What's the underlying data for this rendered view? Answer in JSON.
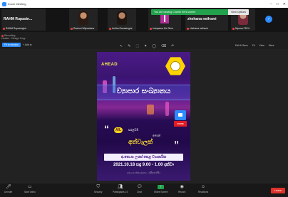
{
  "window": {
    "title": "Zoom Meeting"
  },
  "share_banner": {
    "message": "You are viewing Charith HX's screen",
    "options_label": "View Options"
  },
  "participants": [
    {
      "name": "RAHM Rupasin...",
      "label": "RAHM Rupasinghe",
      "type": "name-only"
    },
    {
      "name": "Rashmi Wijesekara",
      "type": "video"
    },
    {
      "name": "Anitha Ranasinghe",
      "type": "video"
    },
    {
      "name": "Indupama De Silva",
      "type": "avatar"
    },
    {
      "name": "zhehana nethsmi",
      "label": "zhehana nethsmi",
      "type": "name-only"
    },
    {
      "name": "Nipuna FDCL",
      "type": "video"
    }
  ],
  "share_toolbar": {
    "recording_label": "Recording",
    "speaker_label": "Header · Design Copy",
    "view_label": "Fit to window",
    "add_label": "Add to",
    "tools": [
      "↖",
      "✎",
      "⬚",
      "✦",
      "◯",
      "⌫",
      "↶"
    ],
    "right_tools": [
      "Edit & Save",
      "Fit",
      "View",
      "More"
    ]
  },
  "poster": {
    "logo_text": "AHEAD",
    "title": "ව්‍යාපාර සංඛ්‍යානය",
    "al_badge": "A/L",
    "sub1": "සරලවම",
    "sub2": "අපෙන්",
    "big_word": "අත්වැලක්",
    "zoom_label": "ZOOM",
    "host": "අ.පො.ස උසස් පෙළ ව්‍යාපාරික",
    "datetime": "2021.10.18 සඳු 9.00 - 1.00 දක්වා",
    "footer": "ගුරු මාර්ගෝපදේශනය · ඉදිරිපත් කිරීම"
  },
  "controls": [
    {
      "label": "Unmute",
      "icon": "mic-icon"
    },
    {
      "label": "Start Video",
      "icon": "video-icon"
    },
    {
      "label": "Security",
      "icon": "shield-icon"
    },
    {
      "label": "Participants",
      "icon": "participants-icon",
      "count": "14"
    },
    {
      "label": "Chat",
      "icon": "chat-icon"
    },
    {
      "label": "Share Screen",
      "icon": "share-icon"
    },
    {
      "label": "Record",
      "icon": "record-icon"
    },
    {
      "label": "Reactions",
      "icon": "reactions-icon"
    }
  ],
  "leave_label": "Leave",
  "colors": {
    "zoom_blue": "#2d8cff",
    "share_green": "#23a24d",
    "leave_red": "#e0322b",
    "poster_purple": "#4a1b86"
  }
}
